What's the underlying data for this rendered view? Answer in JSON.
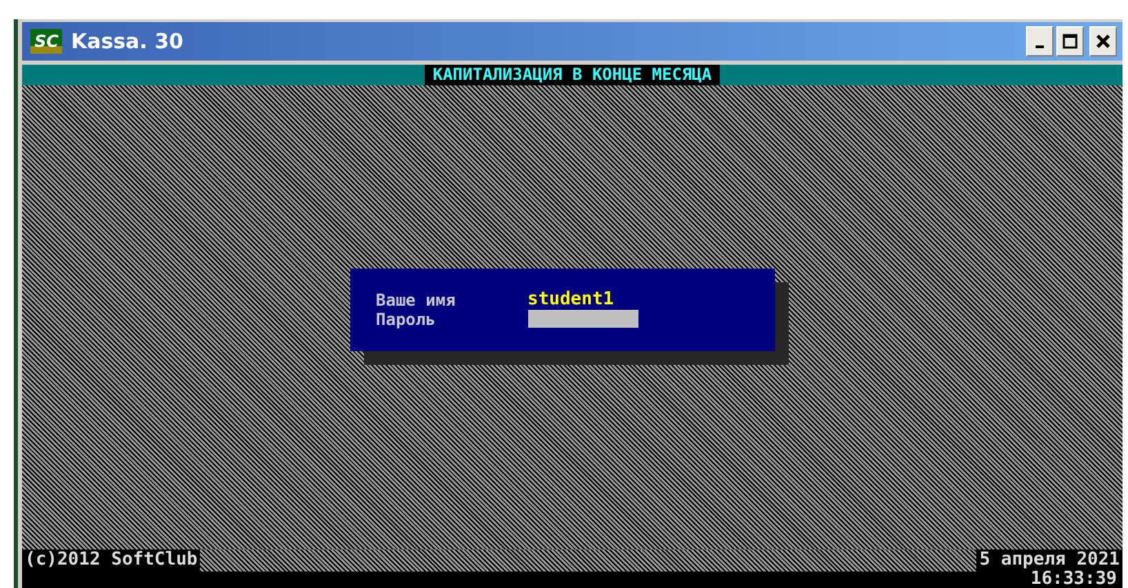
{
  "window": {
    "title": "Kassa. 30",
    "app_icon_text": "SC"
  },
  "screen_title": "КАПИТАЛИЗАЦИЯ В КОНЦЕ МЕСЯЦА",
  "login": {
    "fields": [
      {
        "label": "Ваше имя",
        "kind": "text",
        "value": "student1"
      },
      {
        "label": "Пароль",
        "kind": "password"
      }
    ]
  },
  "status_bar": {
    "copyright": "(c)2012 SoftClub",
    "date": "5 апреля 2021",
    "time": "16:33:39"
  }
}
